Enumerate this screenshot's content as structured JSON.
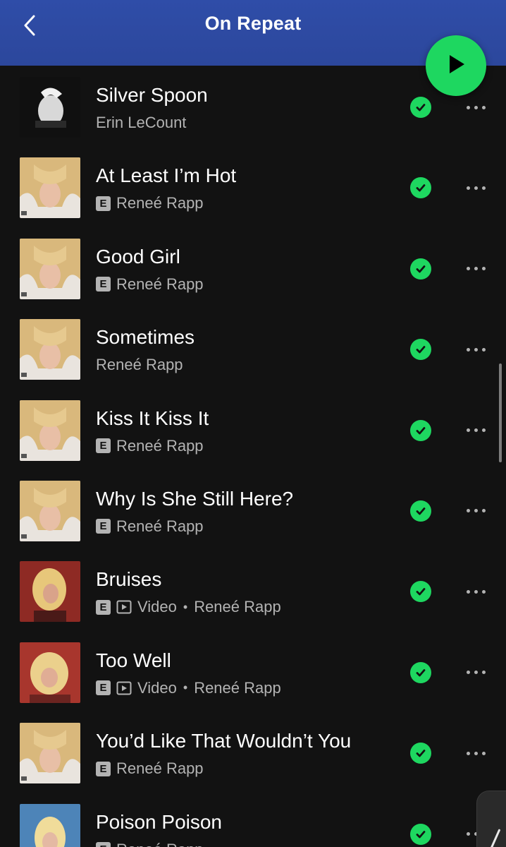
{
  "header": {
    "title": "On Repeat",
    "back_icon": "chevron-left-icon",
    "play_icon": "play-icon",
    "color": "#2c479c",
    "accent": "#1ed760"
  },
  "tracks": [
    {
      "title": "Silver Spoon",
      "artist": "Erin LeCount",
      "explicit": false,
      "video": false,
      "cover": "dark"
    },
    {
      "title": "At Least I’m Hot",
      "artist": "Reneé Rapp",
      "explicit": true,
      "video": false,
      "cover": "blonde"
    },
    {
      "title": "Good Girl",
      "artist": "Reneé Rapp",
      "explicit": true,
      "video": false,
      "cover": "blonde"
    },
    {
      "title": "Sometimes",
      "artist": "Reneé Rapp",
      "explicit": false,
      "video": false,
      "cover": "blonde"
    },
    {
      "title": "Kiss It Kiss It",
      "artist": "Reneé Rapp",
      "explicit": true,
      "video": false,
      "cover": "blonde"
    },
    {
      "title": "Why Is She Still Here?",
      "artist": "Reneé Rapp",
      "explicit": true,
      "video": false,
      "cover": "blonde"
    },
    {
      "title": "Bruises",
      "artist": "Reneé Rapp",
      "explicit": true,
      "video": true,
      "video_label": "Video",
      "cover": "red"
    },
    {
      "title": "Too Well",
      "artist": "Reneé Rapp",
      "explicit": true,
      "video": true,
      "video_label": "Video",
      "cover": "red2"
    },
    {
      "title": "You’d Like That Wouldn’t You",
      "artist": "Reneé Rapp",
      "explicit": true,
      "video": false,
      "cover": "blonde"
    },
    {
      "title": "Poison Poison",
      "artist": "Reneé Rapp",
      "explicit": true,
      "video": false,
      "cover": "blue"
    }
  ],
  "labels": {
    "explicit_badge": "E",
    "separator": "•"
  },
  "icons": {
    "downloaded": "check-circle-icon",
    "more": "more-options-icon",
    "video": "video-icon"
  },
  "colors": {
    "background": "#121212",
    "text_primary": "#ffffff",
    "text_secondary": "#b3b3b3",
    "downloaded_green": "#1ed760"
  }
}
